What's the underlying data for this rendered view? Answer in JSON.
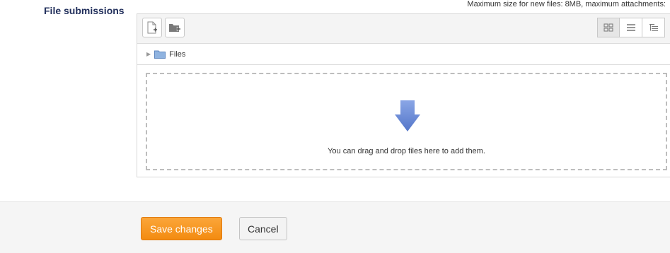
{
  "field": {
    "label": "File submissions",
    "limits_text": "Maximum size for new files: 8MB, maximum attachments:"
  },
  "file_manager": {
    "toolbar": {
      "add_icon": "add-file-icon",
      "create_folder_icon": "create-folder-icon",
      "view_modes": [
        "icons-view-icon",
        "list-view-icon",
        "tree-view-icon"
      ],
      "active_view": "icons"
    },
    "path": {
      "folder_label": "Files"
    },
    "dropzone": {
      "message": "You can drag and drop files here to add them."
    }
  },
  "actions": {
    "save_label": "Save changes",
    "cancel_label": "Cancel"
  },
  "colors": {
    "label": "#1f2d5a",
    "save_button": "#f7941d",
    "arrow": "#6f8fd6",
    "folder": "#8fb3e0"
  }
}
